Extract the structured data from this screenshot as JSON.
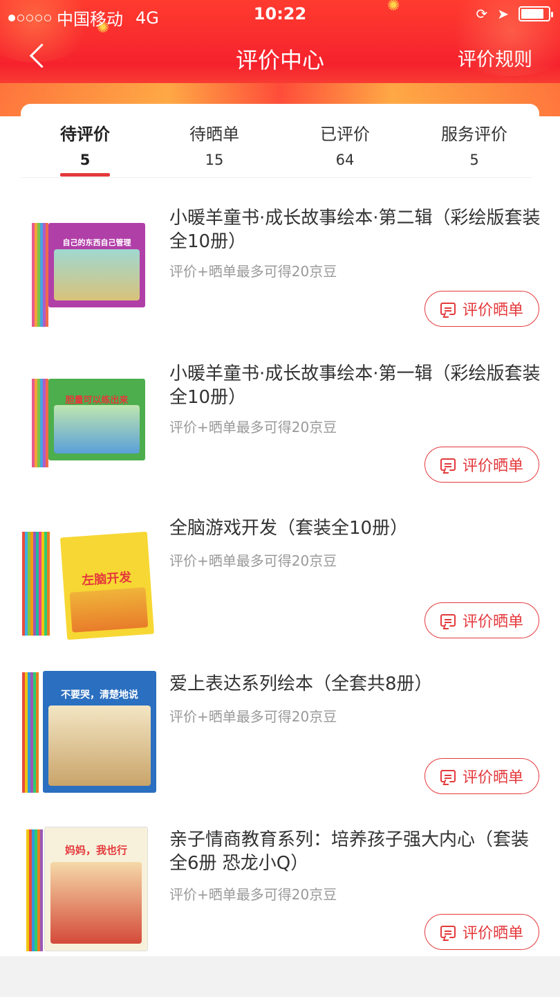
{
  "status_bar": {
    "carrier": "中国移动",
    "network": "4G",
    "time": "10:22",
    "battery_level": 0.85
  },
  "nav": {
    "title": "评价中心",
    "right_link": "评价规则"
  },
  "tabs": [
    {
      "label": "待评价",
      "count": "5",
      "active": true
    },
    {
      "label": "待晒单",
      "count": "15",
      "active": false
    },
    {
      "label": "已评价",
      "count": "64",
      "active": false
    },
    {
      "label": "服务评价",
      "count": "5",
      "active": false
    }
  ],
  "products": [
    {
      "title": "小暖羊童书·成长故事绘本·第二辑（彩绘版套装全10册）",
      "reward": "评价+晒单最多可得20京豆",
      "button": "评价晒单",
      "cover_text": "自己的东西自己管理",
      "cover_color": "#b13fa8"
    },
    {
      "title": "小暖羊童书·成长故事绘本·第一辑（彩绘版套装全10册）",
      "reward": "评价+晒单最多可得20京豆",
      "button": "评价晒单",
      "cover_text": "胆量可以练出来",
      "cover_color": "#4cae4c"
    },
    {
      "title": "全脑游戏开发（套装全10册）",
      "reward": "评价+晒单最多可得20京豆",
      "button": "评价晒单",
      "cover_text": "左脑开发",
      "cover_color": "#f7d733"
    },
    {
      "title": "爱上表达系列绘本（全套共8册）",
      "reward": "评价+晒单最多可得20京豆",
      "button": "评价晒单",
      "cover_text": "不要哭，清楚地说",
      "cover_color": "#2a6fc0"
    },
    {
      "title": "亲子情商教育系列：培养孩子强大内心（套装全6册 恐龙小Q）",
      "reward": "评价+晒单最多可得20京豆",
      "button": "评价晒单",
      "cover_text": "妈妈，我也行",
      "cover_color": "#f7f1dc"
    }
  ],
  "colors": {
    "accent": "#e4393c",
    "header": "#f5222d"
  }
}
